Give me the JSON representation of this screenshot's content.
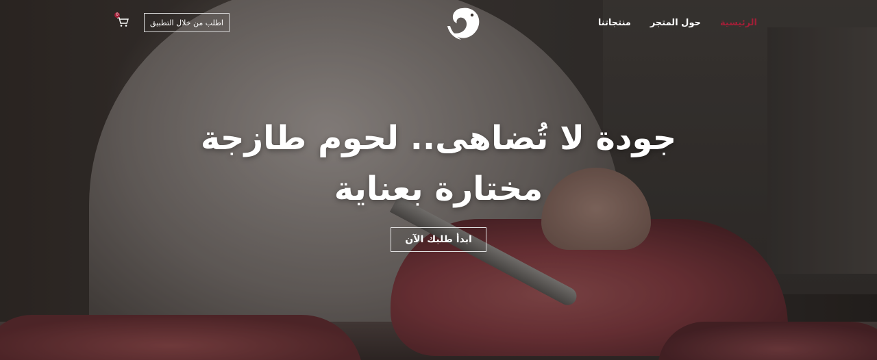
{
  "nav": {
    "menu": [
      {
        "label": "الرئيسية",
        "active": true
      },
      {
        "label": "حول المتجر",
        "active": false
      },
      {
        "label": "منتجاتنا",
        "active": false
      }
    ],
    "order_app_label": "اطلب من خلال التطبيق",
    "cart_count": "0",
    "logo_icon": "ram-head-logo",
    "cart_icon": "shopping-cart-icon"
  },
  "hero": {
    "headline_line1": "جودة لا تُضاهى.. لحوم طازجة",
    "headline_line2": "مختارة بعناية",
    "cta_label": "ابدأ طلبك الآن"
  },
  "colors": {
    "accent": "#a11f37",
    "text": "#ffffff"
  }
}
